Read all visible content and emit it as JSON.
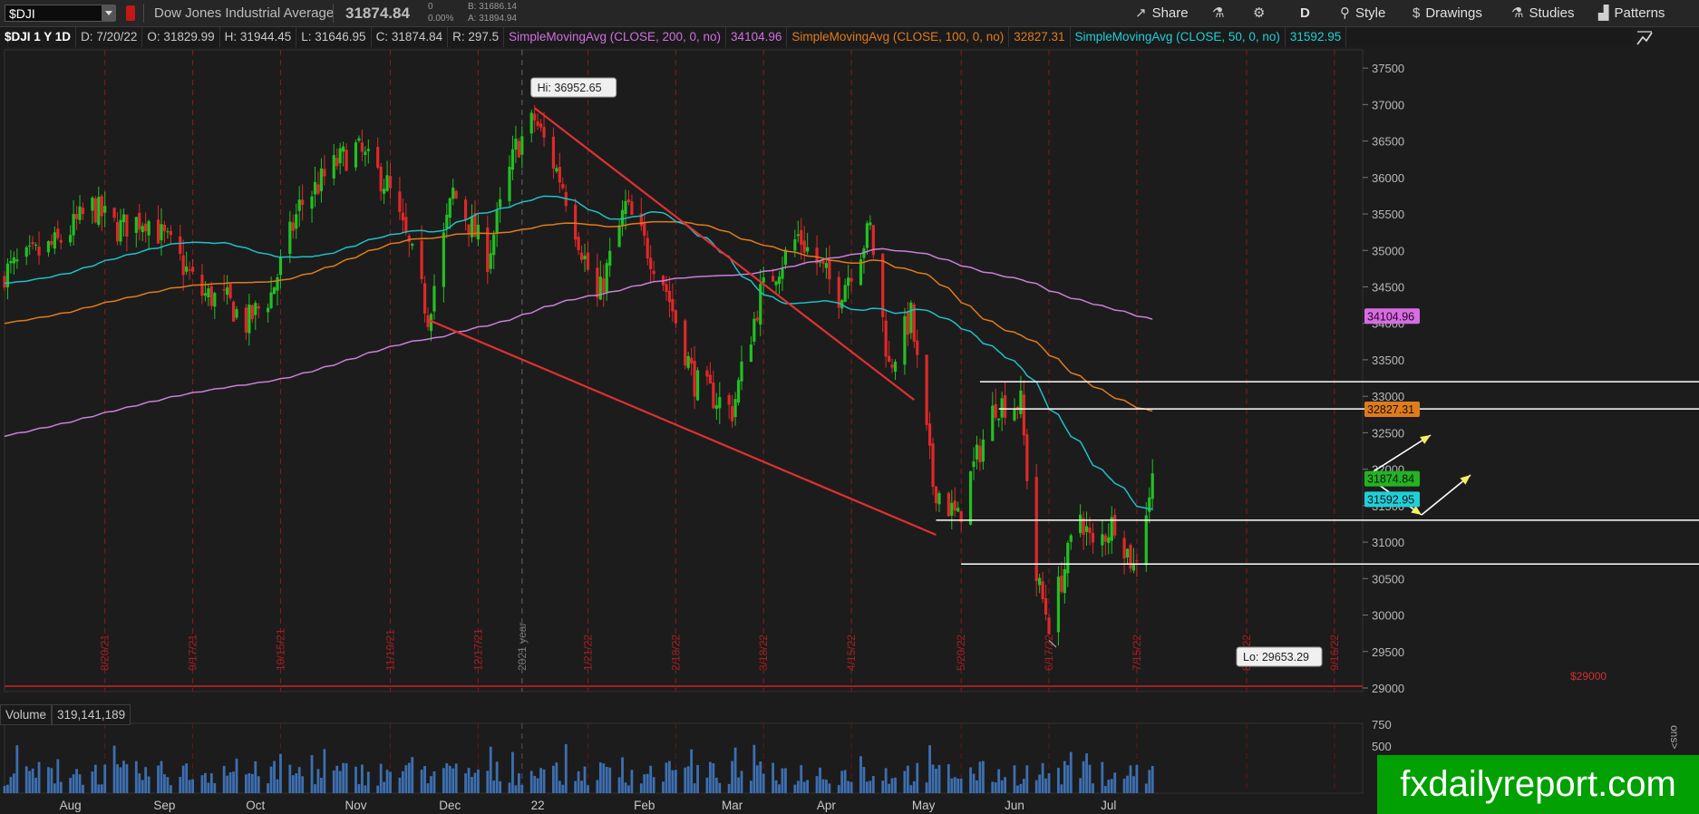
{
  "toolbar": {
    "symbol": "$DJI",
    "instrument_name": "Dow Jones Industrial Average",
    "last_price": "31874.84",
    "change_top": "0",
    "change_pct": "0.00%",
    "bid": "B: 31686.14",
    "ask": "A: 31894.94",
    "share_label": "Share",
    "period_label": "D",
    "style_label": "Style",
    "drawings_label": "Drawings",
    "studies_label": "Studies",
    "patterns_label": "Patterns"
  },
  "legend": {
    "symbol_period": "$DJI 1 Y 1D",
    "date": "D: 7/20/22",
    "open": "O: 31829.99",
    "high": "H: 31944.45",
    "low": "L: 31646.95",
    "close": "C: 31874.84",
    "range": "R: 297.5",
    "sma200_label": "SimpleMovingAvg (CLOSE, 200, 0, no)",
    "sma200_value": "34104.96",
    "sma100_label": "SimpleMovingAvg (CLOSE, 100, 0, no)",
    "sma100_value": "32827.31",
    "sma50_label": "SimpleMovingAvg (CLOSE, 50, 0, no)",
    "sma50_value": "31592.95"
  },
  "volume_panel": {
    "label": "Volume",
    "value": "319,141,189",
    "ticks": [
      "750",
      "500"
    ]
  },
  "brand": "fxdailyreport.com",
  "side_tab": "ons>",
  "chart_data": {
    "type": "candlestick",
    "y_ticks": [
      29000,
      29500,
      30000,
      30500,
      31000,
      31500,
      32000,
      32500,
      33000,
      33500,
      34000,
      34500,
      35000,
      35500,
      36000,
      36500,
      37000,
      37500
    ],
    "ylim": [
      28950,
      37750
    ],
    "months": [
      "Aug",
      "Sep",
      "Oct",
      "Nov",
      "Dec",
      "22",
      "Feb",
      "Mar",
      "Apr",
      "May",
      "Jun",
      "Jul"
    ],
    "vertical_date_labels": [
      "8/20/21",
      "9/17/21",
      "10/15/21",
      "11/19/21",
      "12/17/21",
      "2021 year",
      "1/21/22",
      "2/18/22",
      "3/18/22",
      "4/15/22",
      "5/20/22",
      "6/17/22",
      "7/15/22",
      "8/19/22",
      "9/16/22"
    ],
    "high_label": "Hi: 36952.65",
    "low_label": "Lo: 29653.29",
    "axis_floor_label": "$29000",
    "price_tags": [
      {
        "value": 34104.96,
        "label": "34104.96",
        "color": "#d66ee0"
      },
      {
        "value": 32827.31,
        "label": "32827.31",
        "color": "#e07b1c"
      },
      {
        "value": 31874.84,
        "label": "31874.84",
        "color": "#22b422"
      },
      {
        "value": 31592.95,
        "label": "31592.95",
        "color": "#1fd0d8"
      }
    ],
    "horizontal_levels": [
      33200,
      32827,
      31300,
      30700
    ],
    "trendlines": [
      {
        "from": [
          "2022-01-04",
          36952
        ],
        "to": [
          "2022-05-05",
          32950
        ],
        "color": "#e03030"
      },
      {
        "from": [
          "2021-12-01",
          34050
        ],
        "to": [
          "2022-05-12",
          31100
        ],
        "color": "#e03030"
      }
    ],
    "series": [
      {
        "name": "SimpleMovingAvg (CLOSE, 200, 0, no)",
        "color": "#c880d8"
      },
      {
        "name": "SimpleMovingAvg (CLOSE, 100, 0, no)",
        "color": "#e07b1c"
      },
      {
        "name": "SimpleMovingAvg (CLOSE, 50, 0, no)",
        "color": "#1fc0c8"
      }
    ],
    "grid": false,
    "legend_position": "top"
  }
}
